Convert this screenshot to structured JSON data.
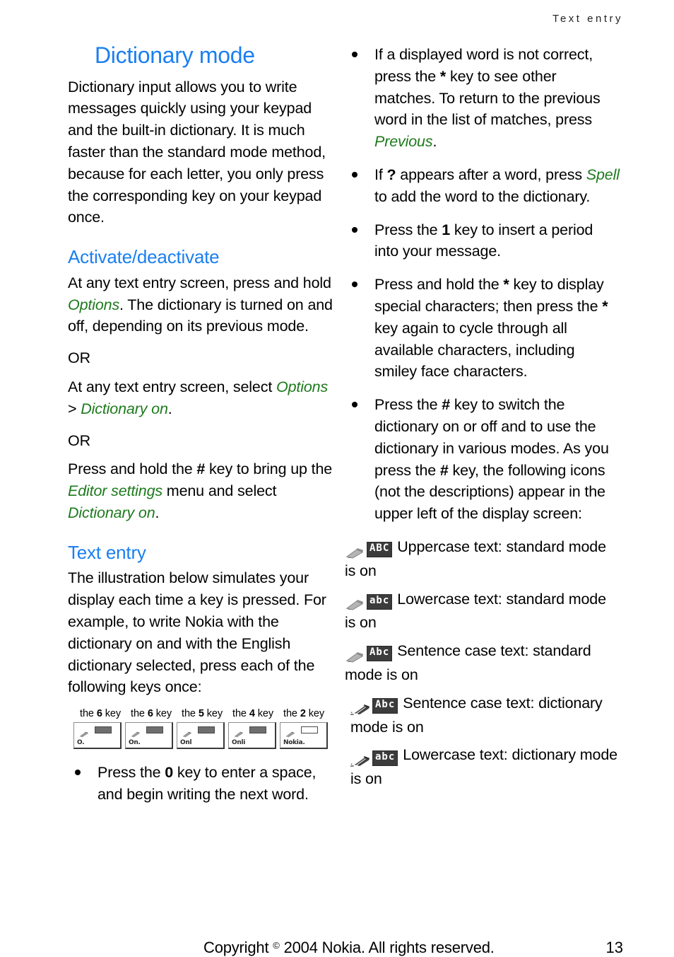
{
  "header": {
    "running_title": "Text entry"
  },
  "left": {
    "title": "Dictionary mode",
    "intro": "Dictionary input allows you to write messages quickly using your keypad and the built-in dictionary. It is much faster than the standard mode method, because for each letter, you only press the corresponding key on your keypad once.",
    "section_activate": {
      "heading": "Activate/deactivate",
      "p1_a": "At any text entry screen, press and hold ",
      "p1_link": "Options",
      "p1_b": ". The dictionary is turned on and off, depending on its previous mode.",
      "or1": "OR",
      "p2_a": "At any text entry screen, select ",
      "p2_link1": "Options",
      "p2_sep": " > ",
      "p2_link2": "Dictionary on",
      "p2_b": ".",
      "or2": "OR",
      "p3_a": "Press and hold the ",
      "p3_key": "#",
      "p3_b": " key to bring up the ",
      "p3_link1": "Editor settings",
      "p3_c": " menu and select ",
      "p3_link2": "Dictionary on",
      "p3_d": "."
    },
    "section_textentry": {
      "heading": "Text entry",
      "p1": "The illustration below simulates your display each time a key is pressed. For example, to write Nokia with the dictionary on and with the English dictionary selected, press each of the following keys once:"
    },
    "keycaps": [
      {
        "pre": "the ",
        "key": "6",
        "post": " key"
      },
      {
        "pre": "the ",
        "key": "6",
        "post": " key"
      },
      {
        "pre": "the ",
        "key": "5",
        "post": " key"
      },
      {
        "pre": "the ",
        "key": "4",
        "post": " key"
      },
      {
        "pre": "the ",
        "key": "2",
        "post": " key"
      }
    ],
    "screens": [
      {
        "word": "O."
      },
      {
        "word": "On."
      },
      {
        "word": "Onl"
      },
      {
        "word": "Onli"
      },
      {
        "word": "Nokia."
      }
    ],
    "bullets": [
      {
        "parts": [
          {
            "t": "Press the ",
            "s": "plain"
          },
          {
            "t": "0",
            "s": "bold"
          },
          {
            "t": " key to enter a space, and begin writing the next word.",
            "s": "plain"
          }
        ]
      }
    ]
  },
  "right": {
    "bullets": [
      {
        "parts": [
          {
            "t": "If a displayed word is not correct, press the ",
            "s": "plain"
          },
          {
            "t": "*",
            "s": "bold"
          },
          {
            "t": " key to see other matches. To return to the previous word in the list of matches, press ",
            "s": "plain"
          },
          {
            "t": "Previous",
            "s": "green"
          },
          {
            "t": ".",
            "s": "plain"
          }
        ]
      },
      {
        "parts": [
          {
            "t": "If ",
            "s": "plain"
          },
          {
            "t": "?",
            "s": "bold"
          },
          {
            "t": " appears after a word, press ",
            "s": "plain"
          },
          {
            "t": "Spell",
            "s": "green"
          },
          {
            "t": " to add the word to the dictionary.",
            "s": "plain"
          }
        ]
      },
      {
        "parts": [
          {
            "t": "Press the ",
            "s": "plain"
          },
          {
            "t": "1",
            "s": "bold"
          },
          {
            "t": " key to insert a period into your message.",
            "s": "plain"
          }
        ]
      },
      {
        "parts": [
          {
            "t": "Press and hold the ",
            "s": "plain"
          },
          {
            "t": "*",
            "s": "bold"
          },
          {
            "t": " key to display special characters; then press the ",
            "s": "plain"
          },
          {
            "t": "*",
            "s": "bold"
          },
          {
            "t": " key again to cycle through all available characters, including smiley face characters.",
            "s": "plain"
          }
        ]
      },
      {
        "parts": [
          {
            "t": "Press the ",
            "s": "plain"
          },
          {
            "t": "#",
            "s": "bold"
          },
          {
            "t": " key to switch the dictionary on or off and to use the dictionary in various modes. As you press the ",
            "s": "plain"
          },
          {
            "t": "#",
            "s": "bold"
          },
          {
            "t": " key, the following icons (not the descriptions) appear in the upper left of the display screen:",
            "s": "plain"
          }
        ]
      }
    ],
    "icon_rows": [
      {
        "pencil": "pencil-outline-icon",
        "abc_label": "ABC",
        "abc_style": "inverted",
        "description": "Uppercase text: standard mode is on",
        "indent": false
      },
      {
        "pencil": "pencil-outline-icon",
        "abc_label": "abc",
        "abc_style": "inverted",
        "description": "Lowercase text: standard mode is on",
        "indent": false
      },
      {
        "pencil": "pencil-outline-icon",
        "abc_label": "Abc",
        "abc_style": "inverted",
        "description": "Sentence case text: standard mode is on",
        "indent": false
      },
      {
        "pencil": "pencil-solid-icon",
        "abc_label": "Abc",
        "abc_style": "inverted",
        "description": "Sentence case text: dictionary mode is on",
        "indent": true
      },
      {
        "pencil": "pencil-solid-icon",
        "abc_label": "abc",
        "abc_style": "inverted",
        "description": "Lowercase text: dictionary mode is on",
        "indent": true
      }
    ]
  },
  "footer": {
    "copyright_pre": "Copyright ",
    "copyright_sup": "©",
    "copyright_post": " 2004 Nokia. All rights reserved.",
    "page_number": "13"
  },
  "colors": {
    "heading_blue": "#1a7ff0",
    "link_green": "#1d7a1d",
    "text_black": "#000000"
  }
}
